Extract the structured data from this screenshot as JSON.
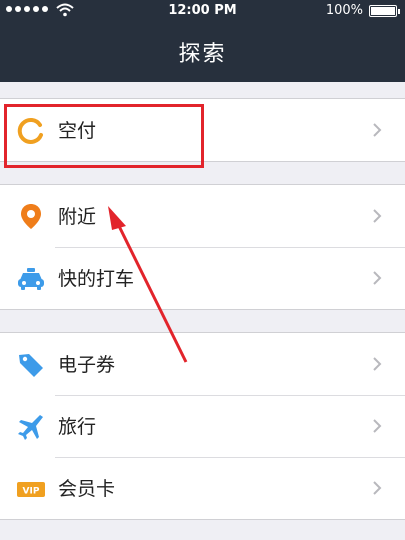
{
  "status_bar": {
    "time": "12:00 PM",
    "battery": "100%",
    "battery_level": 1.0
  },
  "nav": {
    "title": "探索"
  },
  "groups": [
    {
      "items": [
        {
          "label": "空付",
          "icon": "kongfu-ring-icon",
          "icon_color": "#f0a020"
        }
      ]
    },
    {
      "items": [
        {
          "label": "附近",
          "icon": "location-pin-icon",
          "icon_color": "#ef7d1a"
        },
        {
          "label": "快的打车",
          "icon": "taxi-icon",
          "icon_color": "#3d9be9"
        }
      ]
    },
    {
      "items": [
        {
          "label": "电子券",
          "icon": "coupon-tag-icon",
          "icon_color": "#3d9be9"
        },
        {
          "label": "旅行",
          "icon": "airplane-icon",
          "icon_color": "#3d9be9"
        },
        {
          "label": "会员卡",
          "icon": "vip-card-icon",
          "icon_color": "#f0a020",
          "icon_text": "VIP"
        }
      ]
    }
  ],
  "colors": {
    "header_bg": "#27303d",
    "annotation_red": "#e2242b",
    "page_bg": "#efeff4"
  }
}
